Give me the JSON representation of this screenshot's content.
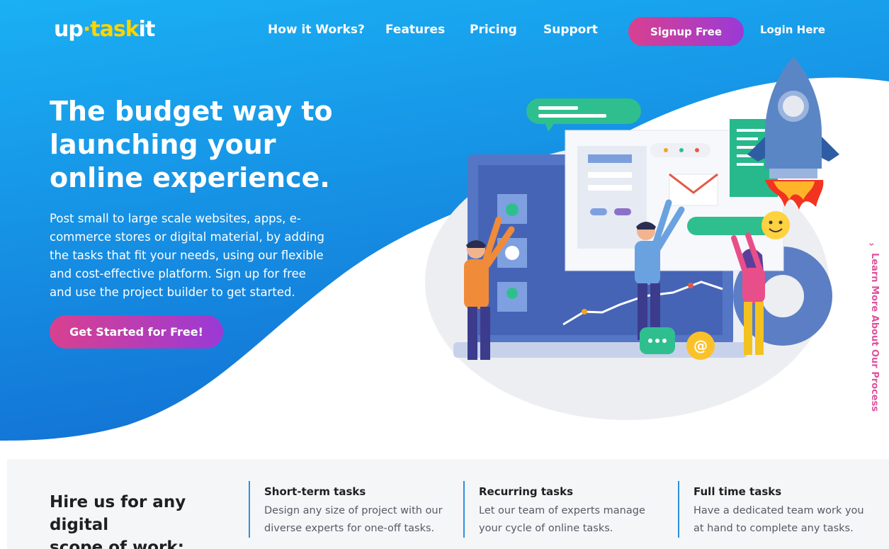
{
  "brand": {
    "logo_part1": "up",
    "logo_dot": "·",
    "logo_part2": "task",
    "logo_part3": "it"
  },
  "nav": {
    "items": [
      {
        "label": "How it Works?"
      },
      {
        "label": "Features"
      },
      {
        "label": "Pricing"
      },
      {
        "label": "Support"
      }
    ],
    "signup_label": "Signup Free",
    "login_label": "Login Here"
  },
  "hero": {
    "title_lines": [
      "The budget way to",
      "launching your",
      "online experience."
    ],
    "description_lines": [
      "Post small to large scale websites, apps, e-",
      "commerce stores or digital material, by adding",
      "the tasks that fit your needs, using our flexible",
      "and cost-effective platform. Sign up for free",
      "and use the project builder to get started."
    ],
    "cta_label": "Get Started for Free!"
  },
  "side_link": {
    "label": "Learn More About Our Process"
  },
  "services": {
    "heading_lines": [
      "Hire us for any digital",
      "scope of work:"
    ],
    "items": [
      {
        "title": "Short-term tasks",
        "desc_lines": [
          "Design any size of project with our",
          "diverse experts for one-off tasks."
        ]
      },
      {
        "title": "Recurring tasks",
        "desc_lines": [
          "Let our team of experts manage",
          "your cycle of online tasks."
        ]
      },
      {
        "title": "Full time tasks",
        "desc_lines": [
          "Have a dedicated team work you",
          "at hand to complete any tasks."
        ]
      }
    ]
  },
  "colors": {
    "hero_blue_top": "#1aa8f2",
    "hero_blue_bottom": "#1474d6",
    "cta_pink": "#d9408f",
    "cta_purple": "#9a3ad6",
    "logo_yellow": "#ffd400",
    "divider_blue": "#2f8fde",
    "side_link_pink": "#e0529b"
  }
}
